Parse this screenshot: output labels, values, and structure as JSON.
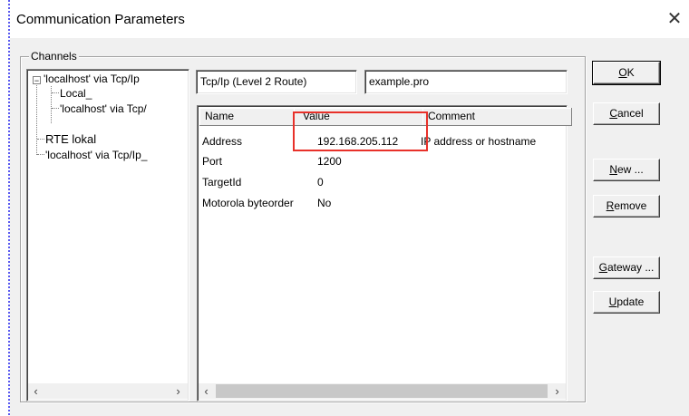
{
  "dialog": {
    "title": "Communication Parameters",
    "close_glyph": "✕"
  },
  "channels": {
    "group_label": "Channels",
    "tree": [
      {
        "label": "'localhost' via Tcp/Ip",
        "level": 0,
        "expanded": true,
        "expander": "−"
      },
      {
        "label": "Local_",
        "level": 1
      },
      {
        "label": "'localhost' via Tcp/",
        "level": 1
      },
      {
        "label": "RTE lokal",
        "level": 0
      },
      {
        "label": "'localhost' via Tcp/Ip_",
        "level": 0
      }
    ],
    "scroll_left": "‹",
    "scroll_right": "›"
  },
  "fields": {
    "driver": "Tcp/Ip (Level 2 Route)",
    "project": "example.pro"
  },
  "params": {
    "columns": {
      "name": "Name",
      "value": "Value",
      "comment": "Comment"
    },
    "rows": [
      {
        "name": "Address",
        "value": "192.168.205.112",
        "comment": "IP address or hostname"
      },
      {
        "name": "Port",
        "value": "1200",
        "comment": ""
      },
      {
        "name": "TargetId",
        "value": "0",
        "comment": ""
      },
      {
        "name": "Motorola byteorder",
        "value": "No",
        "comment": ""
      }
    ],
    "scroll_left": "‹",
    "scroll_right": "›"
  },
  "buttons": {
    "ok": {
      "mnemonic": "O",
      "rest": "K"
    },
    "cancel": {
      "mnemonic": "C",
      "rest": "ancel"
    },
    "new": {
      "mnemonic": "N",
      "rest": "ew ..."
    },
    "remove": {
      "mnemonic": "R",
      "rest": "emove"
    },
    "gateway": {
      "mnemonic": "G",
      "rest": "ateway ..."
    },
    "update": {
      "mnemonic": "U",
      "rest": "pdate"
    }
  },
  "annotation": {
    "highlight_color": "#e8312a"
  }
}
